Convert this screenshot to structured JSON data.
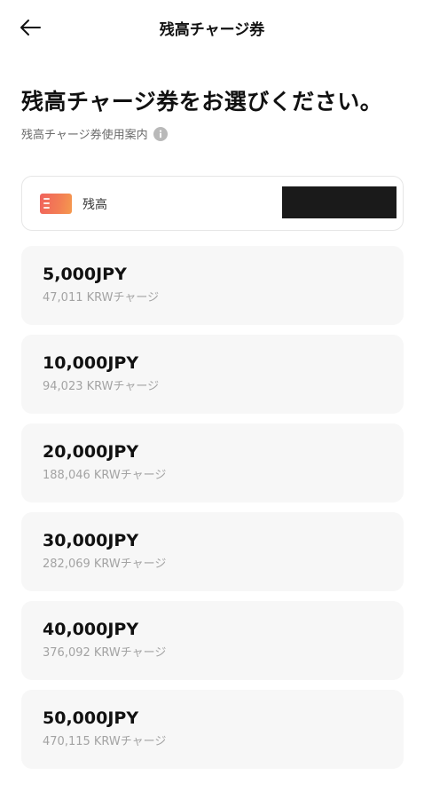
{
  "header": {
    "title": "残高チャージ券",
    "back_icon": "arrow-left-icon"
  },
  "main": {
    "heading": "残高チャージ券をお選びください。",
    "guide_link": "残高チャージ券使用案内",
    "info_icon": "info-icon"
  },
  "balance": {
    "label": "残高",
    "value": "",
    "card_icon": "credit-card-icon",
    "card_colors": [
      "#f0625d",
      "#f59a4e"
    ]
  },
  "vouchers": [
    {
      "amount": "5,000JPY",
      "charge": "47,011 KRWチャージ"
    },
    {
      "amount": "10,000JPY",
      "charge": "94,023 KRWチャージ"
    },
    {
      "amount": "20,000JPY",
      "charge": "188,046 KRWチャージ"
    },
    {
      "amount": "30,000JPY",
      "charge": "282,069 KRWチャージ"
    },
    {
      "amount": "40,000JPY",
      "charge": "376,092 KRWチャージ"
    },
    {
      "amount": "50,000JPY",
      "charge": "470,115 KRWチャージ"
    }
  ]
}
